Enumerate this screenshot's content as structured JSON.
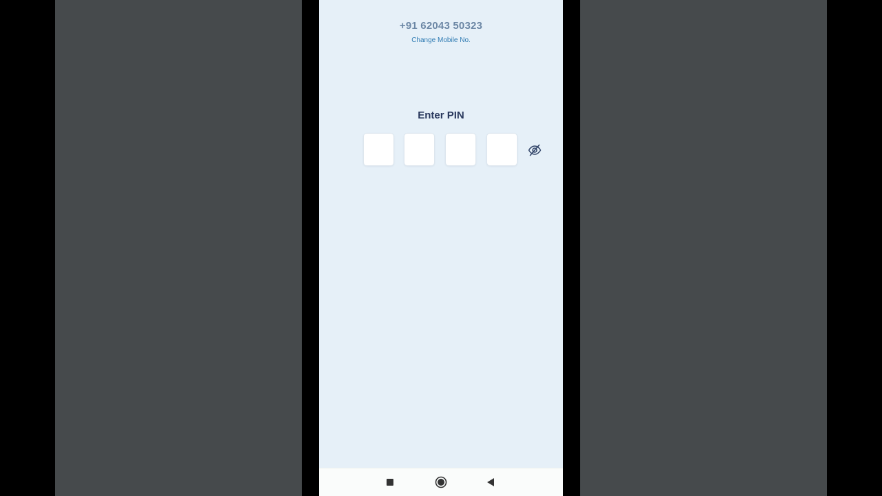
{
  "login": {
    "phone_number": "+91 62043 50323",
    "change_mobile_label": "Change Mobile No.",
    "pin_title": "Enter PIN",
    "pin_boxes": [
      "",
      "",
      "",
      ""
    ],
    "visibility_icon": "eye-off-icon"
  },
  "nav_bar": {
    "buttons": [
      {
        "icon": "square-icon",
        "action": "recent-apps"
      },
      {
        "icon": "circle-icon",
        "action": "home"
      },
      {
        "icon": "triangle-back-icon",
        "action": "back"
      }
    ]
  },
  "colors": {
    "screen_background": "#e6f0f8",
    "side_panel": "#464a4c",
    "phone_number_text": "#6c87a5",
    "link_blue": "#2f7bb3",
    "title_navy": "#28375c",
    "pin_box_bg": "#ffffff"
  }
}
